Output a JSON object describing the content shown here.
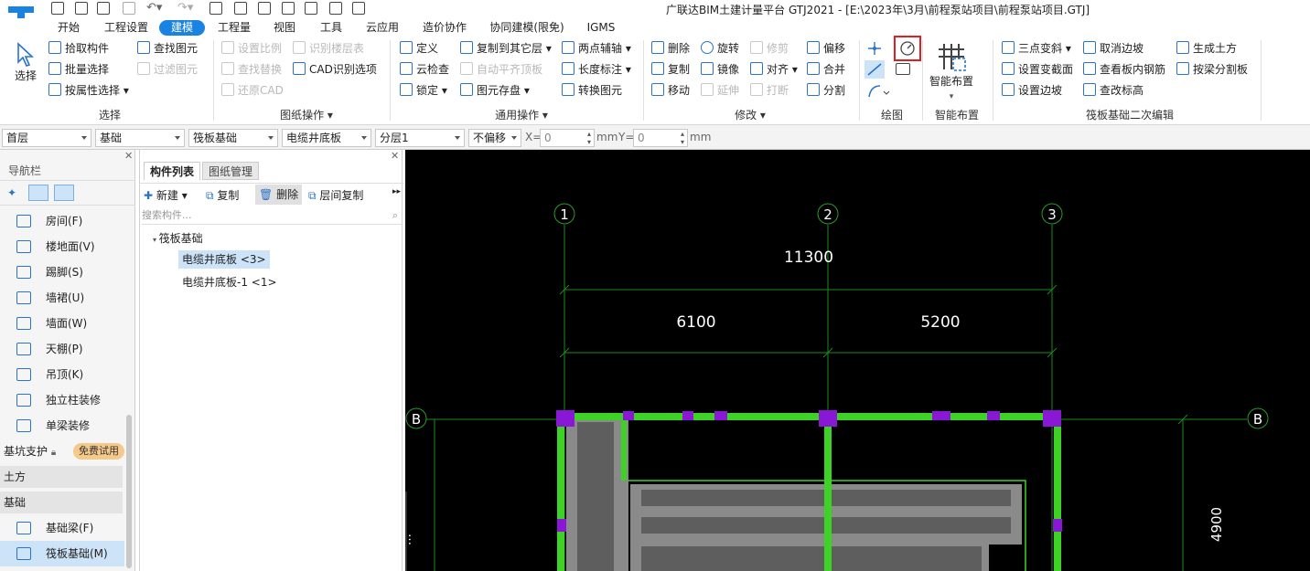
{
  "app": {
    "title": "广联达BIM土建计量平台 GTJ2021 - [E:\\2023年\\3月\\前程泵站项目\\前程泵站项目.GTJ]"
  },
  "menu_tabs": [
    {
      "label": "开始"
    },
    {
      "label": "工程设置"
    },
    {
      "label": "建模",
      "active": true
    },
    {
      "label": "工程量"
    },
    {
      "label": "视图"
    },
    {
      "label": "工具"
    },
    {
      "label": "云应用"
    },
    {
      "label": "造价协作"
    },
    {
      "label": "协同建模(限免)"
    },
    {
      "label": "IGMS"
    }
  ],
  "ribbon": {
    "select": {
      "big_label": "选择",
      "items": [
        "拾取构件",
        "批量选择",
        "按属性选择"
      ],
      "items2": [
        "查找图元",
        "过滤图元"
      ],
      "group_label": "选择"
    },
    "drawing_ops": {
      "items": [
        "设置比例",
        "查找替换",
        "还原CAD"
      ],
      "items2": [
        "识别楼层表",
        "CAD识别选项"
      ],
      "group_label": "图纸操作"
    },
    "general_ops": {
      "col1": [
        "定义",
        "云检查",
        "锁定"
      ],
      "col2": [
        "复制到其它层",
        "自动平齐顶板",
        "图元存盘"
      ],
      "col3": [
        "两点辅轴",
        "长度标注",
        "转换图元"
      ],
      "group_label": "通用操作"
    },
    "modify": {
      "col1": [
        "删除",
        "复制",
        "移动"
      ],
      "col2": [
        "旋转",
        "镜像",
        "延伸"
      ],
      "col3": [
        "修剪",
        "对齐",
        "打断"
      ],
      "col4": [
        "偏移",
        "合并",
        "分割"
      ],
      "group_label": "修改"
    },
    "draw": {
      "group_label": "绘图"
    },
    "smart": {
      "big_label": "智能布置",
      "group_label": "智能布置"
    },
    "raft_edit": {
      "col1": [
        "三点变斜",
        "设置变截面",
        "设置边坡"
      ],
      "col2": [
        "取消边坡",
        "查看板内钢筋",
        "查改标高"
      ],
      "col3": [
        "生成土方",
        "按梁分割板"
      ],
      "group_label": "筏板基础二次编辑"
    }
  },
  "selectors": {
    "floor": "首层",
    "category": "基础",
    "type": "筏板基础",
    "component": "电缆井底板",
    "layer": "分层1",
    "offset": "不偏移",
    "x_label": "X=",
    "x_value": "0",
    "x_unit": "mm",
    "y_label": "Y=",
    "y_value": "0",
    "y_unit": "mm"
  },
  "nav": {
    "title": "导航栏",
    "items": [
      {
        "label": "房间(F)"
      },
      {
        "label": "楼地面(V)"
      },
      {
        "label": "踢脚(S)"
      },
      {
        "label": "墙裙(U)"
      },
      {
        "label": "墙面(W)"
      },
      {
        "label": "天棚(P)"
      },
      {
        "label": "吊顶(K)"
      },
      {
        "label": "独立柱装修"
      },
      {
        "label": "单梁装修"
      }
    ],
    "pit_support": "基坑支护",
    "trial_badge": "免费试用",
    "section_earth": "土方",
    "section_foundation": "基础",
    "foundation_items": [
      {
        "label": "基础梁(F)"
      },
      {
        "label": "筏板基础(M)"
      }
    ]
  },
  "components": {
    "tab_list": "构件列表",
    "tab_drawing": "图纸管理",
    "toolbar": [
      "新建",
      "复制",
      "删除",
      "层间复制"
    ],
    "search_placeholder": "搜索构件...",
    "tree_root": "筏板基础",
    "tree_items": [
      {
        "label": "电缆井底板 <3>",
        "selected": true
      },
      {
        "label": "电缆井底板-1 <1>"
      }
    ]
  },
  "canvas": {
    "axes_top": [
      "1",
      "2",
      "3"
    ],
    "axes_side": [
      "B",
      "B"
    ],
    "dim_total": "11300",
    "dim_left": "6100",
    "dim_right": "5200",
    "dim_vertical": "4900",
    "colors": {
      "background": "#000000",
      "axis_line": "#1e8a1e",
      "wall": "#3fd226",
      "column": "#8a16d6",
      "slab": "#7a7a7a"
    }
  },
  "colors": {
    "accent": "#1a82e0",
    "highlight_box": "#e02020"
  }
}
